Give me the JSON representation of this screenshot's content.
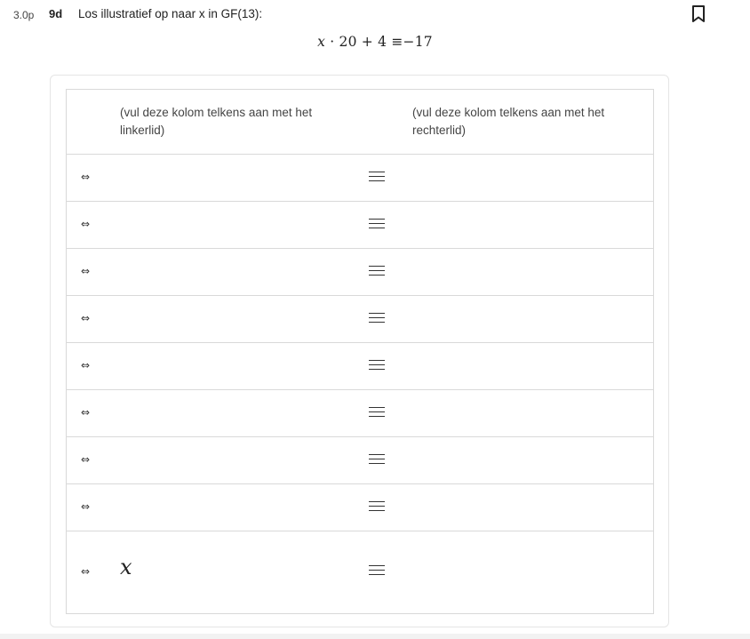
{
  "question": {
    "points": "3.0p",
    "number": "9d",
    "text": "Los illustratief op naar x in GF(13):",
    "bookmark_icon": "bookmark-icon"
  },
  "equation": {
    "var": "x",
    "dot": "·",
    "coef": "20",
    "plus": "+",
    "const": "4",
    "rel": "≡",
    "rhs": "−17"
  },
  "table": {
    "headers": {
      "left": "(vul deze kolom telkens aan met het linkerlid)",
      "right": "(vul deze kolom telkens aan met het rechterlid)"
    },
    "rows": [
      {
        "symbol": "⇔",
        "lhs": "",
        "rhs": ""
      },
      {
        "symbol": "⇔",
        "lhs": "",
        "rhs": ""
      },
      {
        "symbol": "⇔",
        "lhs": "",
        "rhs": ""
      },
      {
        "symbol": "⇔",
        "lhs": "",
        "rhs": ""
      },
      {
        "symbol": "⇔",
        "lhs": "",
        "rhs": ""
      },
      {
        "symbol": "⇔",
        "lhs": "",
        "rhs": ""
      },
      {
        "symbol": "⇔",
        "lhs": "",
        "rhs": ""
      },
      {
        "symbol": "⇔",
        "lhs": "",
        "rhs": ""
      }
    ],
    "final_row": {
      "symbol": "⇔",
      "lhs": "x",
      "rhs": ""
    },
    "equiv_icon": "congruence-icon"
  }
}
